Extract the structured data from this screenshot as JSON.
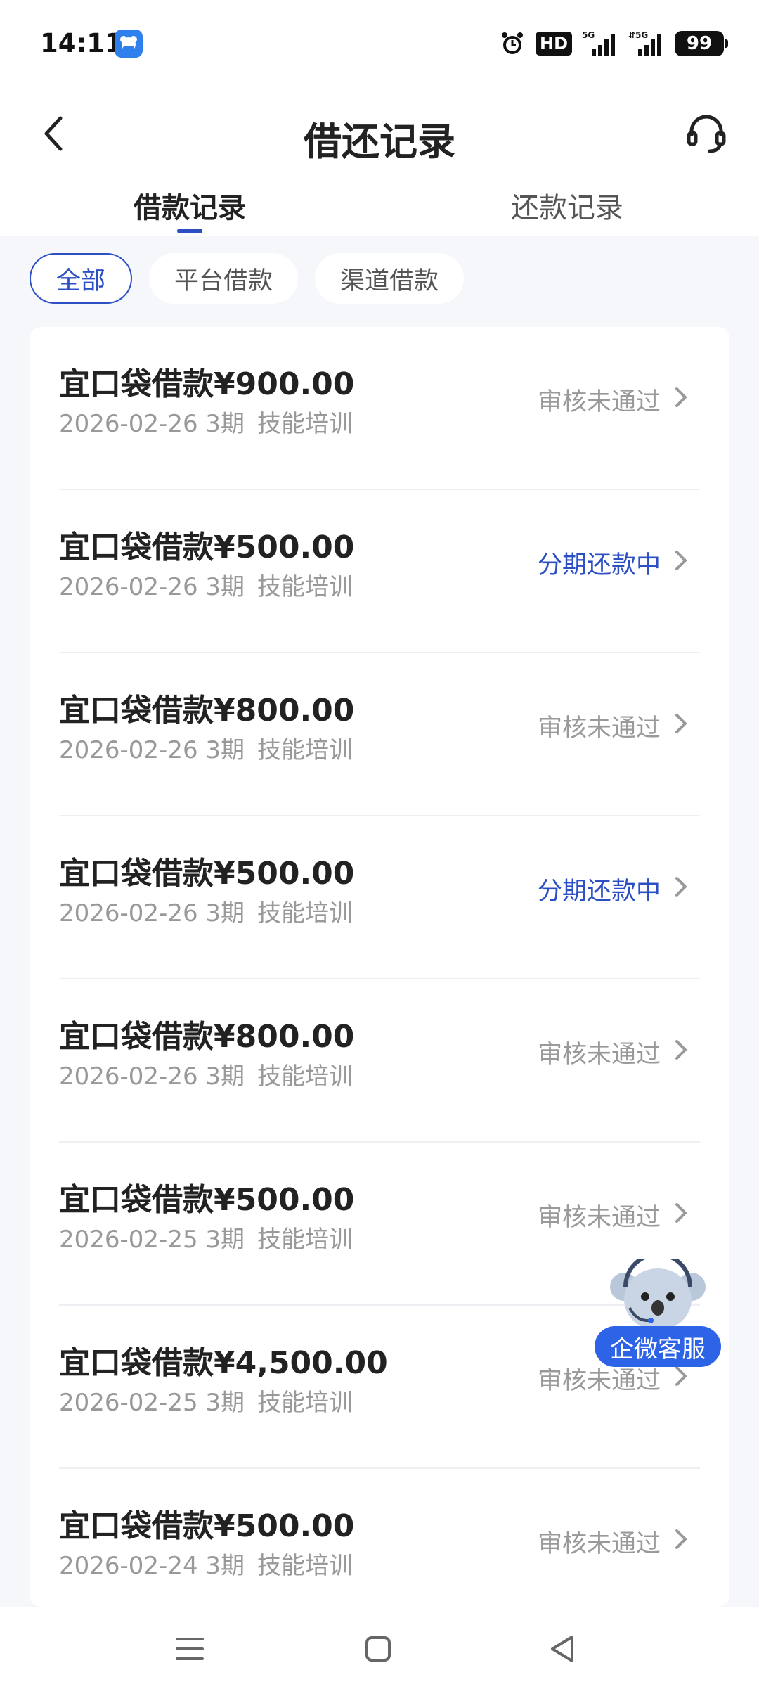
{
  "status_bar": {
    "time": "14:11",
    "app_icon": "app-icon",
    "hd_label": "HD",
    "battery": "99"
  },
  "header": {
    "title": "借还记录"
  },
  "tabs": [
    {
      "label": "借款记录",
      "active": true
    },
    {
      "label": "还款记录",
      "active": false
    }
  ],
  "filters": [
    {
      "label": "全部",
      "active": true
    },
    {
      "label": "平台借款",
      "active": false
    },
    {
      "label": "渠道借款",
      "active": false
    }
  ],
  "records": [
    {
      "title": "宜口袋借款¥900.00",
      "date": "2026-02-26",
      "term": "3期",
      "purpose": "技能培训",
      "status": "审核未通过",
      "status_active": false
    },
    {
      "title": "宜口袋借款¥500.00",
      "date": "2026-02-26",
      "term": "3期",
      "purpose": "技能培训",
      "status": "分期还款中",
      "status_active": true
    },
    {
      "title": "宜口袋借款¥800.00",
      "date": "2026-02-26",
      "term": "3期",
      "purpose": "技能培训",
      "status": "审核未通过",
      "status_active": false
    },
    {
      "title": "宜口袋借款¥500.00",
      "date": "2026-02-26",
      "term": "3期",
      "purpose": "技能培训",
      "status": "分期还款中",
      "status_active": true
    },
    {
      "title": "宜口袋借款¥800.00",
      "date": "2026-02-26",
      "term": "3期",
      "purpose": "技能培训",
      "status": "审核未通过",
      "status_active": false
    },
    {
      "title": "宜口袋借款¥500.00",
      "date": "2026-02-25",
      "term": "3期",
      "purpose": "技能培训",
      "status": "审核未通过",
      "status_active": false
    },
    {
      "title": "宜口袋借款¥4,500.00",
      "date": "2026-02-25",
      "term": "3期",
      "purpose": "技能培训",
      "status": "审核未通过",
      "status_active": false
    },
    {
      "title": "宜口袋借款¥500.00",
      "date": "2026-02-24",
      "term": "3期",
      "purpose": "技能培训",
      "status": "审核未通过",
      "status_active": false
    }
  ],
  "float_support": {
    "label": "企微客服"
  },
  "colors": {
    "accent": "#2d4fc4",
    "muted": "#999999",
    "background": "#f6f7fb"
  }
}
